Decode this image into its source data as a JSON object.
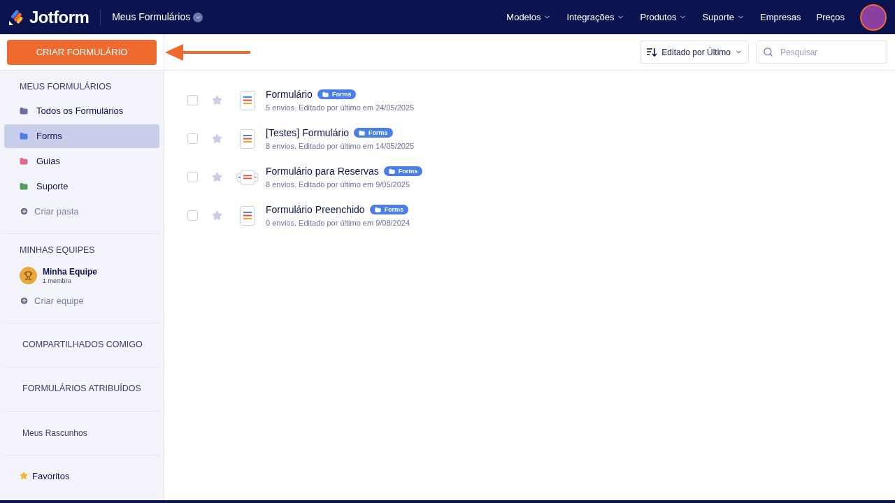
{
  "header": {
    "logo": "Jotform",
    "workspace": "Meus Formulários",
    "nav": [
      {
        "label": "Modelos",
        "dropdown": true
      },
      {
        "label": "Integrações",
        "dropdown": true
      },
      {
        "label": "Produtos",
        "dropdown": true
      },
      {
        "label": "Suporte",
        "dropdown": true
      },
      {
        "label": "Empresas",
        "dropdown": false
      },
      {
        "label": "Preços",
        "dropdown": false
      }
    ]
  },
  "create_button": "CRIAR FORMULÁRIO",
  "sort": {
    "label": "Editado por Último"
  },
  "search": {
    "placeholder": "Pesquisar"
  },
  "sidebar": {
    "my_forms_title": "MEUS FORMULÁRIOS",
    "folders": [
      {
        "label": "Todos os Formulários",
        "color": "#6c6f9f",
        "selected": false
      },
      {
        "label": "Forms",
        "color": "#4a7ee8",
        "selected": true
      },
      {
        "label": "Guias",
        "color": "#e0698a",
        "selected": false
      },
      {
        "label": "Suporte",
        "color": "#4c9e5a",
        "selected": false
      }
    ],
    "create_folder": "Criar pasta",
    "teams_title": "MINHAS EQUIPES",
    "team": {
      "name": "Minha Equipe",
      "members": "1 membro"
    },
    "create_team": "Criar equipe",
    "sections": [
      "COMPARTILHADOS COMIGO",
      "FORMULÁRIOS ATRIBUÍDOS",
      "Meus Rascunhos"
    ],
    "favorites": "Favoritos"
  },
  "forms": [
    {
      "title": "Formulário",
      "folder": "Forms",
      "meta": "5 envios. Editado por último em 24/05/2025",
      "kind": "form",
      "checked": false,
      "starred": false
    },
    {
      "title": "[Testes] Formulário",
      "folder": "Forms",
      "meta": "8 envios. Editado por último em 14/05/2025",
      "kind": "form",
      "checked": false,
      "starred": false
    },
    {
      "title": "Formulário para Reservas",
      "folder": "Forms",
      "meta": "8 envios. Editado por último em 9/05/2025",
      "kind": "card",
      "checked": false,
      "starred": false
    },
    {
      "title": "Formulário Preenchido",
      "folder": "Forms",
      "meta": "0 envios. Editado por último em 9/08/2024",
      "kind": "form",
      "checked": false,
      "starred": false
    }
  ]
}
